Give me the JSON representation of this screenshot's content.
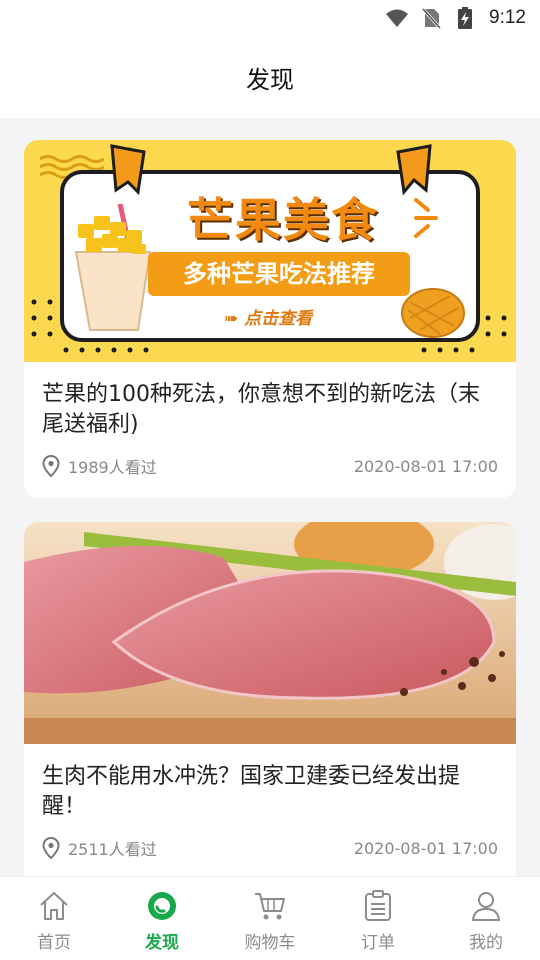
{
  "status_bar": {
    "time": "9:12",
    "icons": [
      "wifi-icon",
      "no-sim-icon",
      "battery-charging-icon"
    ]
  },
  "header": {
    "title": "发现"
  },
  "articles": [
    {
      "banner": {
        "main_text": "芒果美食",
        "sub_text": "多种芒果吃法推荐",
        "cta_text": "点击查看"
      },
      "title": "芒果的100种死法，你意想不到的新吃法（末尾送福利)",
      "views": "1989人看过",
      "date": "2020-08-01 17:00"
    },
    {
      "title": "生肉不能用水冲洗？国家卫建委已经发出提醒！",
      "views": "2511人看过",
      "date": "2020-08-01 17:00"
    }
  ],
  "tabbar": {
    "items": [
      {
        "label": "首页",
        "icon": "home-icon"
      },
      {
        "label": "发现",
        "icon": "discover-icon"
      },
      {
        "label": "购物车",
        "icon": "cart-icon"
      },
      {
        "label": "订单",
        "icon": "order-icon"
      },
      {
        "label": "我的",
        "icon": "profile-icon"
      }
    ],
    "active_index": 1,
    "active_color": "#19a84a",
    "inactive_color": "#8c8c8c"
  }
}
